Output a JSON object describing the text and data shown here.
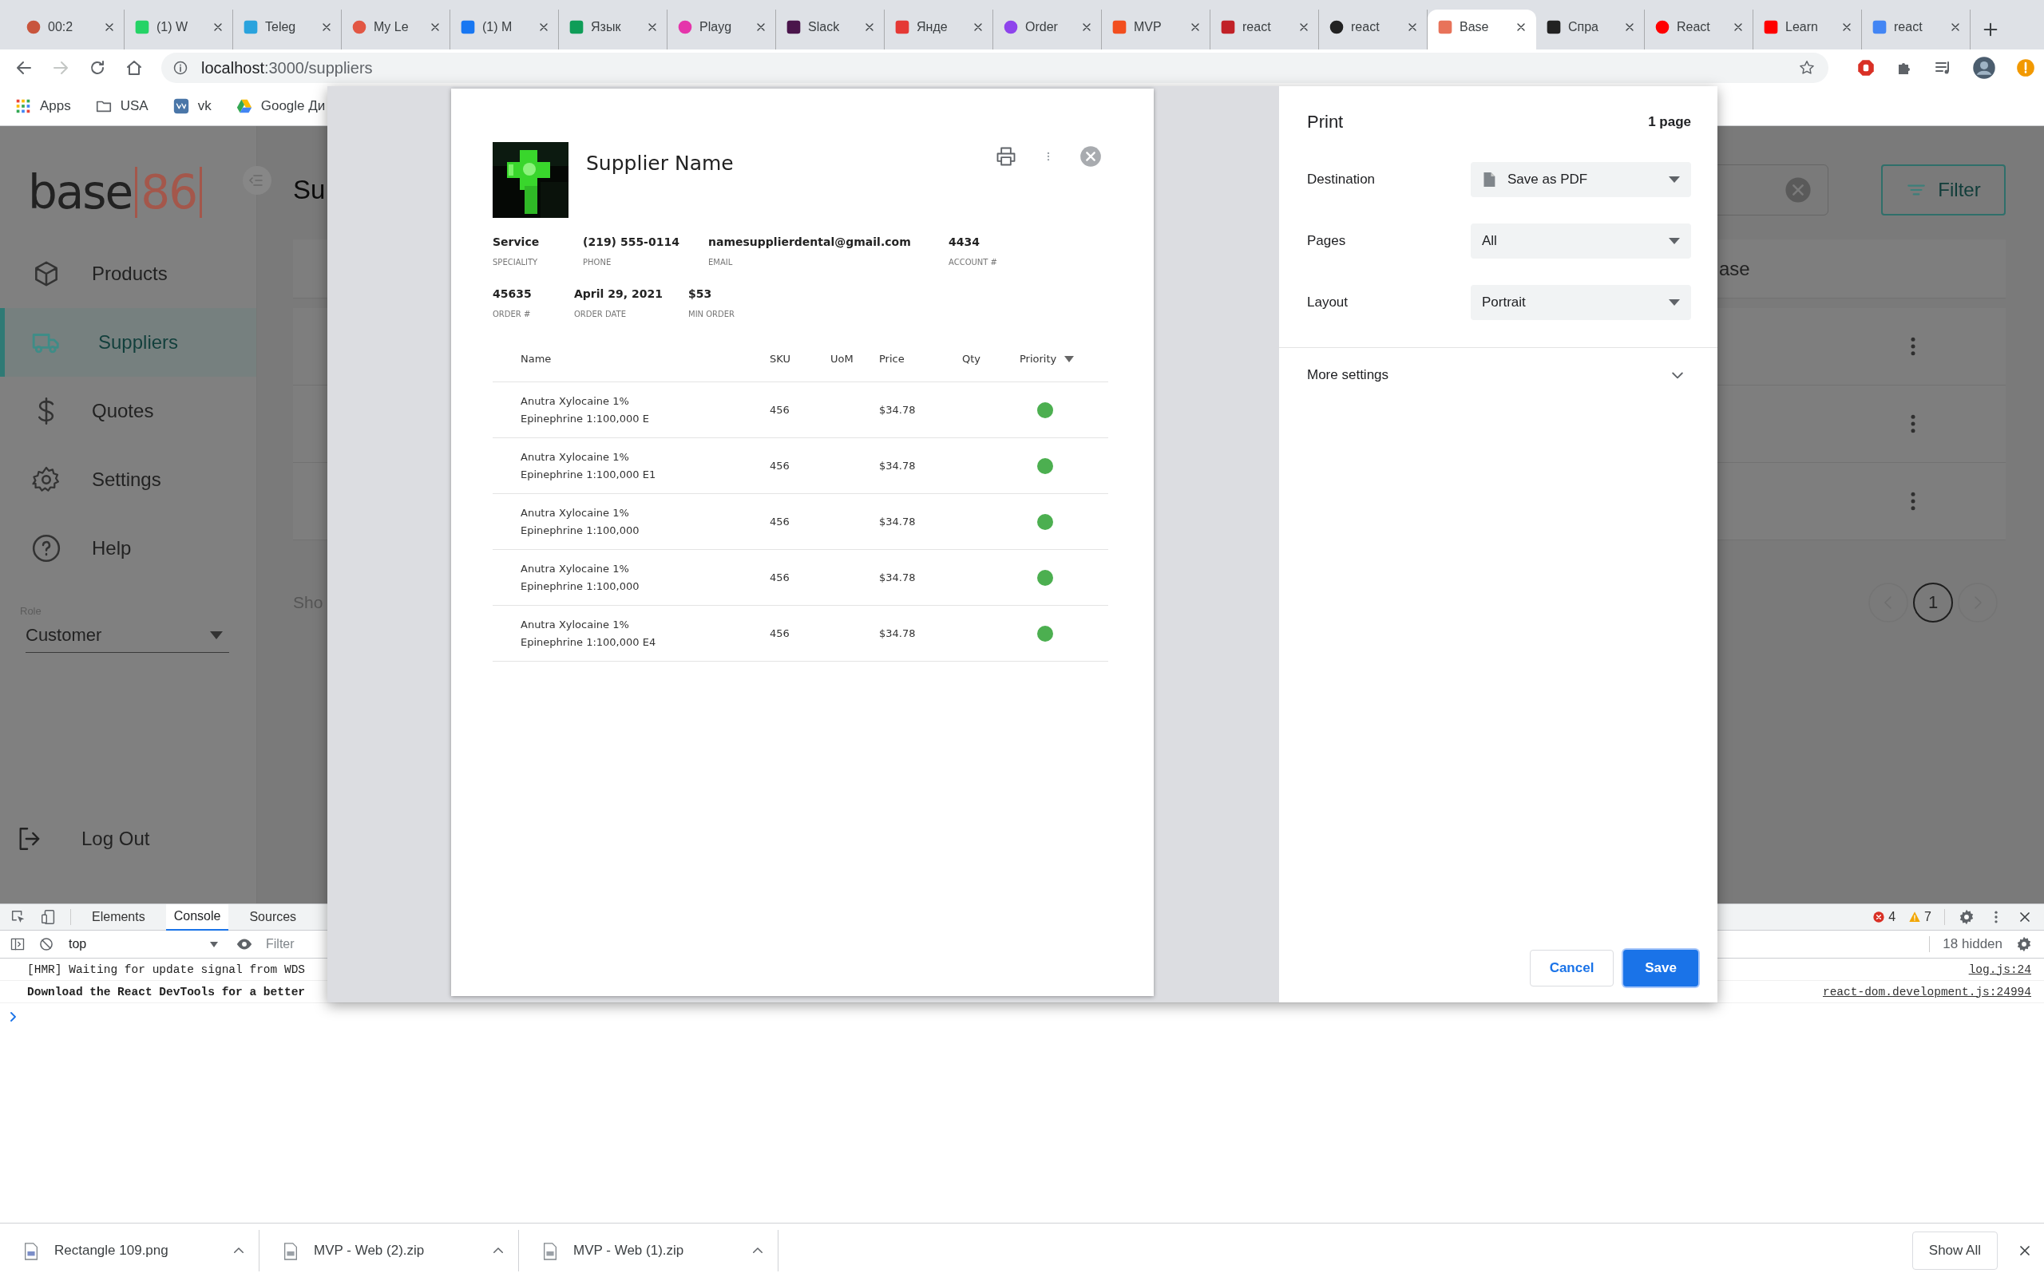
{
  "browser": {
    "tabs": [
      {
        "label": "00:2",
        "selected": false
      },
      {
        "label": "(1) W",
        "selected": false
      },
      {
        "label": "Teleg",
        "selected": false
      },
      {
        "label": "My Le",
        "selected": false
      },
      {
        "label": "(1) M",
        "selected": false
      },
      {
        "label": "Язык",
        "selected": false
      },
      {
        "label": "Playg",
        "selected": false
      },
      {
        "label": "Slack",
        "selected": false
      },
      {
        "label": "Янде",
        "selected": false
      },
      {
        "label": "Order",
        "selected": false
      },
      {
        "label": "MVP",
        "selected": false
      },
      {
        "label": "react",
        "selected": false
      },
      {
        "label": "react",
        "selected": false
      },
      {
        "label": "Base",
        "selected": true
      },
      {
        "label": "Спра",
        "selected": false
      },
      {
        "label": "React",
        "selected": false
      },
      {
        "label": "Learn",
        "selected": false
      },
      {
        "label": "react",
        "selected": false
      }
    ],
    "address": {
      "host": "localhost",
      "path": ":3000/suppliers"
    },
    "bookmarks": [
      "Apps",
      "USA",
      "vk",
      "Google Ди"
    ]
  },
  "app": {
    "logo": {
      "word": "base",
      "number": "86"
    },
    "nav": [
      {
        "label": "Products",
        "selected": false
      },
      {
        "label": "Suppliers",
        "selected": true
      },
      {
        "label": "Quotes",
        "selected": false
      },
      {
        "label": "Settings",
        "selected": false
      },
      {
        "label": "Help",
        "selected": false
      }
    ],
    "role": {
      "label": "Role",
      "value": "Customer"
    },
    "logout": "Log Out",
    "title": "Su",
    "filter_button": "Filter",
    "table": {
      "header": "ase",
      "rows": [
        {
          "has_menu": true
        },
        {
          "has_menu": true
        },
        {
          "has_menu": true
        }
      ]
    },
    "footer_text": "Sho",
    "pages": [
      {
        "label": "1",
        "selected": true
      }
    ]
  },
  "devtools": {
    "tabs": [
      {
        "label": "Elements",
        "selected": false
      },
      {
        "label": "Console",
        "selected": true
      },
      {
        "label": "Sources",
        "selected": false
      }
    ],
    "errors": "4",
    "warnings": "7",
    "context": "top",
    "filter_placeholder": "Filter",
    "hidden": "18 hidden",
    "messages": [
      {
        "text": "[HMR] Waiting for update signal from WDS",
        "source": "log.js:24",
        "bold": false
      },
      {
        "text": "Download the React DevTools for a better",
        "source": "react-dom.development.js:24994",
        "bold": true
      }
    ]
  },
  "downloads": {
    "items": [
      {
        "name": "Rectangle 109.png"
      },
      {
        "name": "MVP - Web (2).zip"
      },
      {
        "name": "MVP - Web (1).zip"
      }
    ],
    "show_all": "Show All"
  },
  "print_preview": {
    "supplier_name": "Supplier Name",
    "field_rows": [
      [
        {
          "value": "Service",
          "label": "SPECIALITY"
        },
        {
          "value": "(219) 555-0114",
          "label": "PHONE"
        },
        {
          "value": "namesupplierdental@gmail.com",
          "label": "EMAIL"
        },
        {
          "value": "4434",
          "label": "ACCOUNT #"
        }
      ],
      [
        {
          "value": "45635",
          "label": "ORDER #"
        },
        {
          "value": "April 29, 2021",
          "label": "ORDER DATE"
        },
        {
          "value": "$53",
          "label": "MIN ORDER"
        }
      ]
    ],
    "columns": [
      {
        "label": "Name",
        "sort_menu": false
      },
      {
        "label": "SKU",
        "sort_menu": false
      },
      {
        "label": "UoM",
        "sort_menu": false
      },
      {
        "label": "Price",
        "sort_menu": false
      },
      {
        "label": "Qty",
        "sort_menu": false
      },
      {
        "label": "Priority",
        "sort_menu": true
      }
    ],
    "rows": [
      {
        "name": "Anutra Xylocaine 1% Epinephrine 1:100,000 E",
        "sku": "456",
        "price": "$34.78",
        "color": "#4caf50"
      },
      {
        "name": "Anutra Xylocaine 1% Epinephrine 1:100,000 E1",
        "sku": "456",
        "price": "$34.78",
        "color": "#4caf50"
      },
      {
        "name": "Anutra Xylocaine 1% Epinephrine 1:100,000",
        "sku": "456",
        "price": "$34.78",
        "color": "#4caf50"
      },
      {
        "name": "Anutra Xylocaine 1% Epinephrine 1:100,000",
        "sku": "456",
        "price": "$34.78",
        "color": "#4caf50"
      },
      {
        "name": "Anutra Xylocaine 1% Epinephrine 1:100,000 E4",
        "sku": "456",
        "price": "$34.78",
        "color": "#4caf50"
      }
    ]
  },
  "print_settings": {
    "title": "Print",
    "page_count": "1 page",
    "settings": [
      {
        "label": "Destination",
        "value": "Save as PDF",
        "kind": "destination"
      },
      {
        "label": "Pages",
        "value": "All",
        "kind": "select"
      },
      {
        "label": "Layout",
        "value": "Portrait",
        "kind": "select"
      }
    ],
    "more_settings": {
      "label": "More settings",
      "expanded": false
    },
    "buttons": [
      {
        "label": "Cancel",
        "kind": "secondary"
      },
      {
        "label": "Save",
        "kind": "primary"
      }
    ]
  }
}
